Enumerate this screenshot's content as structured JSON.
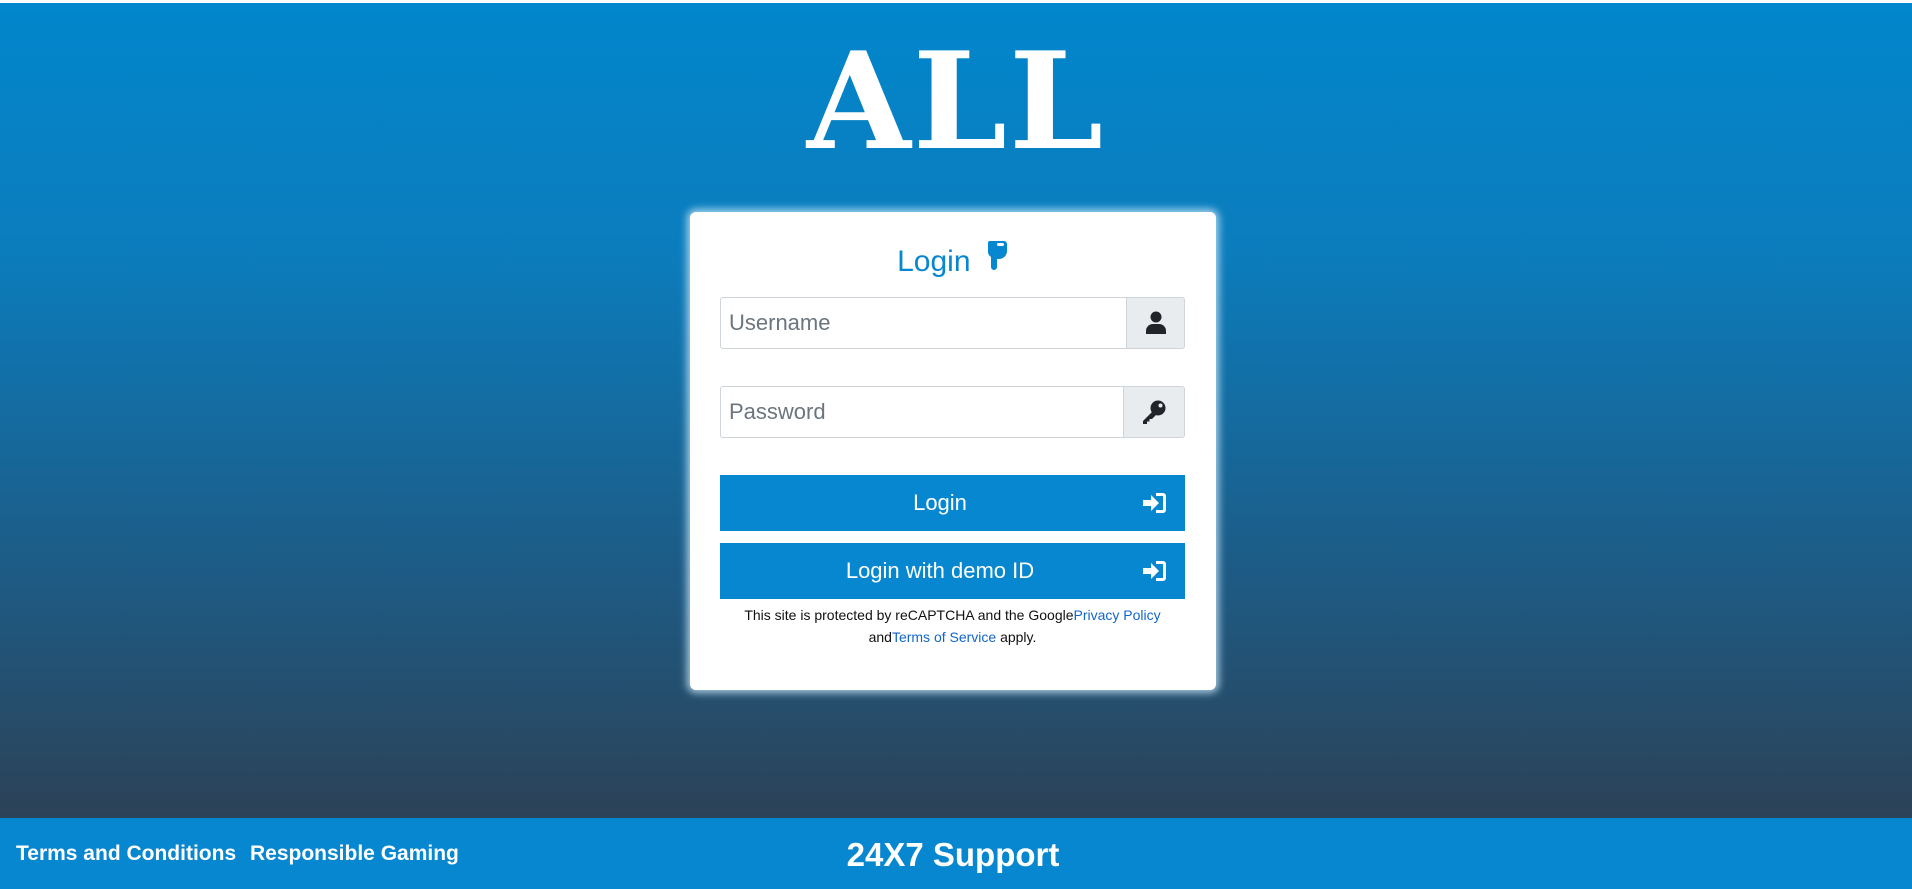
{
  "logo": {
    "text": "ALL"
  },
  "login_card": {
    "title": "Login",
    "title_icon": "hand-pointing-down-icon",
    "username": {
      "placeholder": "Username",
      "value": "",
      "icon": "user-icon"
    },
    "password": {
      "placeholder": "Password",
      "value": "",
      "icon": "key-icon"
    },
    "login_button": {
      "label": "Login",
      "icon": "sign-in-icon"
    },
    "demo_button": {
      "label": "Login with demo ID",
      "icon": "sign-in-icon"
    },
    "recaptcha": {
      "prefix": "This site is protected by reCAPTCHA and the Google",
      "privacy_link": "Privacy Policy",
      "and": " and",
      "terms_link": "Terms of Service",
      "suffix": " apply."
    }
  },
  "footer": {
    "terms_link": "Terms and Conditions",
    "responsible_link": "Responsible Gaming",
    "support": "24X7 Support"
  },
  "colors": {
    "accent": "#0787d0",
    "gradient_top": "#0286cc",
    "gradient_bottom": "#2c4257",
    "addon_bg": "#e9ecef"
  }
}
